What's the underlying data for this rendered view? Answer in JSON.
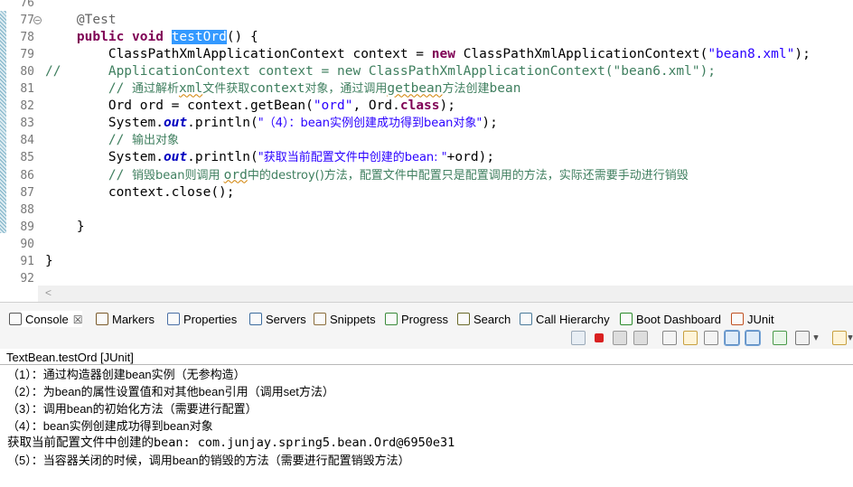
{
  "editor": {
    "lines": [
      {
        "num": "76",
        "segments": []
      },
      {
        "num": "77",
        "fold": "⊖",
        "segments": [
          {
            "t": "    @Test",
            "c": "ann"
          }
        ]
      },
      {
        "num": "78",
        "segments": [
          {
            "t": "    ",
            "c": ""
          },
          {
            "t": "public",
            "c": "kw"
          },
          {
            "t": " ",
            "c": ""
          },
          {
            "t": "void",
            "c": "kw"
          },
          {
            "t": " ",
            "c": ""
          },
          {
            "t": "testOrd",
            "c": "sel"
          },
          {
            "t": "() {",
            "c": ""
          }
        ]
      },
      {
        "num": "79",
        "segments": [
          {
            "t": "        ClassPathXmlApplicationContext context = ",
            "c": ""
          },
          {
            "t": "new",
            "c": "kw"
          },
          {
            "t": " ClassPathXmlApplicationContext(",
            "c": ""
          },
          {
            "t": "\"bean8.xml\"",
            "c": "str"
          },
          {
            "t": ");",
            "c": ""
          }
        ]
      },
      {
        "num": "80",
        "segments": [
          {
            "t": "//      ApplicationContext context = new ClassPathXmlApplicationContext(\"bean6.xml\");",
            "c": "cm"
          }
        ]
      },
      {
        "num": "81",
        "segments": [
          {
            "t": "        // ",
            "c": "cm"
          },
          {
            "t": "通过解析",
            "c": "cm cn"
          },
          {
            "t": "xml",
            "c": "cm sq"
          },
          {
            "t": "文件获取",
            "c": "cm cn"
          },
          {
            "t": "context",
            "c": "cm"
          },
          {
            "t": "对象，通过调用",
            "c": "cm cn"
          },
          {
            "t": "getbean",
            "c": "cm sq"
          },
          {
            "t": "方法创建",
            "c": "cm cn"
          },
          {
            "t": "bean",
            "c": "cm"
          }
        ]
      },
      {
        "num": "82",
        "segments": [
          {
            "t": "        Ord ord = context.getBean(",
            "c": ""
          },
          {
            "t": "\"ord\"",
            "c": "str"
          },
          {
            "t": ", Ord.",
            "c": ""
          },
          {
            "t": "class",
            "c": "kw"
          },
          {
            "t": ");",
            "c": ""
          }
        ]
      },
      {
        "num": "83",
        "segments": [
          {
            "t": "        System.",
            "c": ""
          },
          {
            "t": "out",
            "c": "fld"
          },
          {
            "t": ".println(",
            "c": ""
          },
          {
            "t": "\"（4）：bean实例创建成功得到bean对象\"",
            "c": "str cn"
          },
          {
            "t": ");",
            "c": ""
          }
        ]
      },
      {
        "num": "84",
        "segments": [
          {
            "t": "        // ",
            "c": "cm"
          },
          {
            "t": "输出对象",
            "c": "cm cn"
          }
        ]
      },
      {
        "num": "85",
        "segments": [
          {
            "t": "        System.",
            "c": ""
          },
          {
            "t": "out",
            "c": "fld"
          },
          {
            "t": ".println(",
            "c": ""
          },
          {
            "t": "\"获取当前配置文件中创建的bean: \"",
            "c": "str cn"
          },
          {
            "t": "+ord);",
            "c": ""
          }
        ]
      },
      {
        "num": "86",
        "segments": [
          {
            "t": "        // ",
            "c": "cm"
          },
          {
            "t": "销毁bean则调用 ",
            "c": "cm cn"
          },
          {
            "t": "ord",
            "c": "cm sq"
          },
          {
            "t": "中的destroy()方法，配置文件中配置只是配置调用的方法，实际还需要手动进行销毁",
            "c": "cm cn"
          }
        ]
      },
      {
        "num": "87",
        "segments": [
          {
            "t": "        context.close();",
            "c": ""
          }
        ]
      },
      {
        "num": "88",
        "segments": []
      },
      {
        "num": "89",
        "segments": [
          {
            "t": "    }",
            "c": ""
          }
        ]
      },
      {
        "num": "90",
        "segments": []
      },
      {
        "num": "91",
        "segments": [
          {
            "t": "}",
            "c": ""
          }
        ]
      },
      {
        "num": "92",
        "segments": []
      }
    ],
    "scroll_arrow": "<"
  },
  "tabs": [
    {
      "label": "Console",
      "icon": "console-icon",
      "active": true,
      "close": "☒"
    },
    {
      "label": "Markers",
      "icon": "markers-icon"
    },
    {
      "label": "Properties",
      "icon": "properties-icon"
    },
    {
      "label": "Servers",
      "icon": "servers-icon"
    },
    {
      "label": "Snippets",
      "icon": "snippets-icon"
    },
    {
      "label": "Progress",
      "icon": "progress-icon"
    },
    {
      "label": "Search",
      "icon": "search-icon"
    },
    {
      "label": "Call Hierarchy",
      "icon": "call-hierarchy-icon"
    },
    {
      "label": "Boot Dashboard",
      "icon": "boot-dashboard-icon"
    },
    {
      "label": "JUnit",
      "icon": "junit-icon"
    }
  ],
  "toolbar_icons": [
    "refresh-icon",
    "terminate-icon",
    "remove-launch-icon",
    "remove-all-terminated-icon",
    "clear-console-icon",
    "scroll-lock-icon",
    "word-wrap-icon",
    "show-on-stdout-icon",
    "show-on-stderr-icon",
    "pin-console-icon",
    "display-selected-console-icon",
    "display-selected-console-dropdown-icon",
    "open-console-icon",
    "open-console-dropdown-icon"
  ],
  "console": {
    "title": "TextBean.testOrd [JUnit]",
    "lines": [
      "（1）：通过构造器创建bean实例（无参构造）",
      "（2）：为bean的属性设置值和对其他bean引用（调用set方法）",
      "（3）：调用bean的初始化方法（需要进行配置）",
      "（4）：bean实例创建成功得到bean对象",
      "获取当前配置文件中创建的bean: com.junjay.spring5.bean.Ord@6950e31",
      "（5）：当容器关闭的时候，调用bean的销毁的方法（需要进行配置销毁方法）"
    ]
  },
  "colors": {
    "keyword": "#7f0055",
    "string": "#2a00ff",
    "comment": "#3f7f5f",
    "selection": "#3399ff"
  }
}
